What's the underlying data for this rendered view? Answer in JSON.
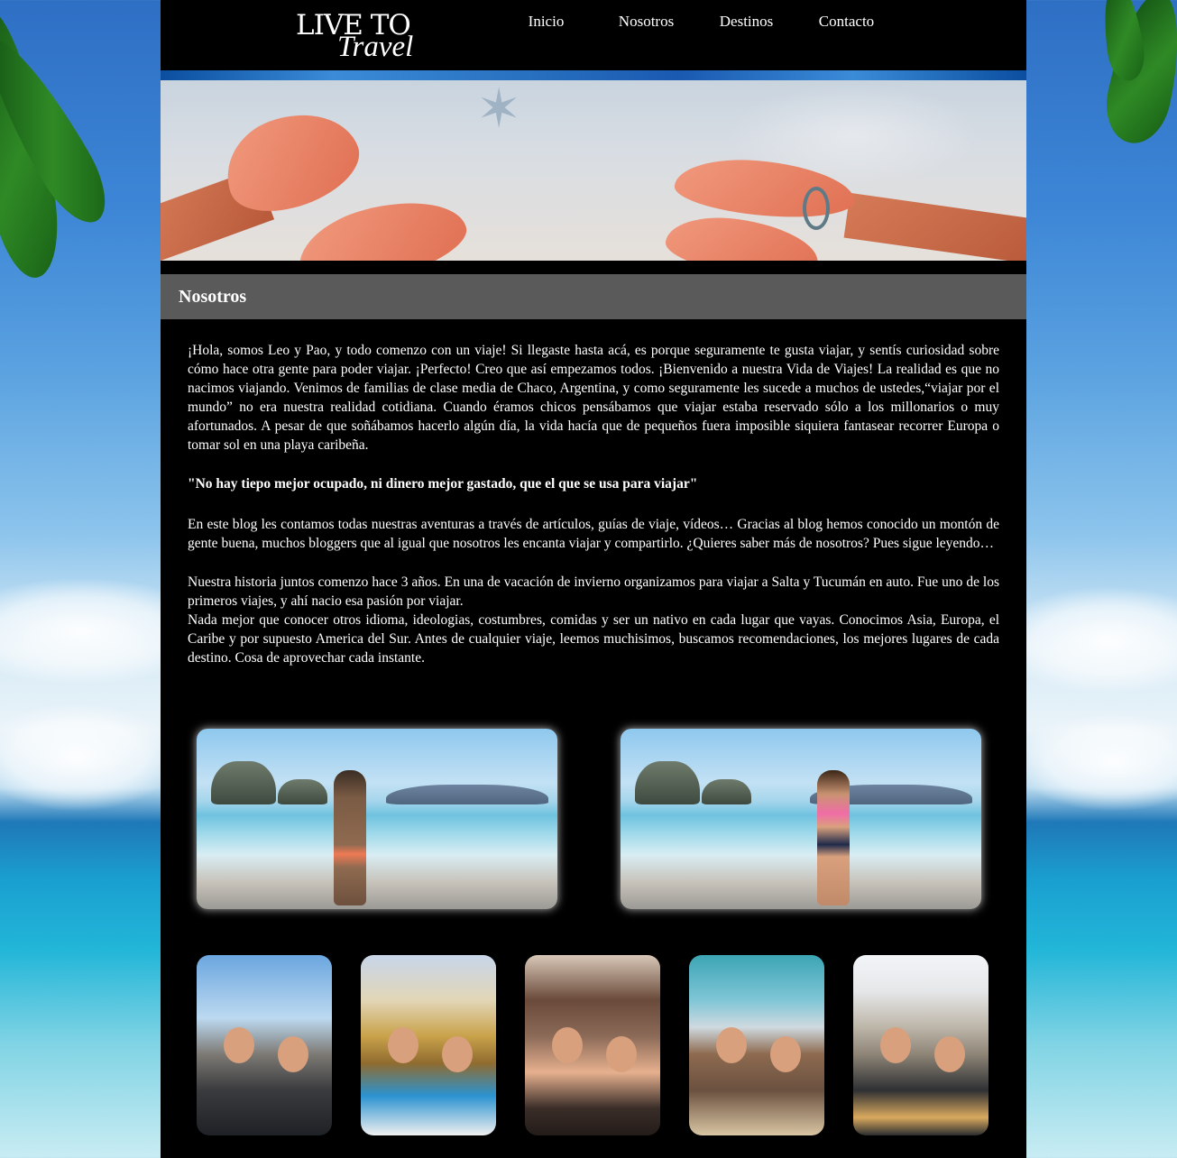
{
  "header": {
    "logo_top": "LIVE TO",
    "logo_bottom": "Travel",
    "nav": [
      "Inicio",
      "Nosotros",
      "Destinos",
      "Contacto"
    ]
  },
  "section": {
    "title": "Nosotros"
  },
  "content": {
    "paragraphs": [
      "¡Hola, somos Leo y Pao, y todo comenzo con un viaje! Si llegaste hasta acá, es porque seguramente te gusta viajar, y sentís curiosidad sobre cómo hace otra gente para poder viajar. ¡Perfecto! Creo que así empezamos todos. ¡Bienvenido a nuestra Vida de Viajes! La realidad es que no nacimos viajando. Venimos de familias de clase media de Chaco, Argentina, y como seguramente les sucede a muchos de ustedes,“viajar por el mundo” no era nuestra realidad cotidiana. Cuando éramos chicos pensábamos que viajar estaba reservado sólo a los millonarios o muy afortunados. A pesar de que soñábamos hacerlo algún día, la vida hacía que de pequeños fuera imposible siquiera fantasear recorrer Europa o tomar sol en una playa caribeña.",
      "\"No hay tiepo mejor ocupado, ni dinero mejor gastado, que el que se usa para viajar\"",
      "En este blog les contamos todas nuestras aventuras a través de artículos, guías de viaje, vídeos… Gracias al blog hemos conocido un montón de gente buena, muchos bloggers que al igual que nosotros les encanta viajar y compartirlo. ¿Quieres saber más de nosotros? Pues sigue leyendo…",
      "Nuestra historia juntos comenzo hace 3 años. En una de vacación de invierno organizamos para viajar a Salta y Tucumán en auto. Fue uno de los primeros viajes, y ahí nacio esa pasión por viajar.",
      "Nada mejor que conocer otros idioma, ideologias, costumbres, comidas y ser un nativo en cada lugar que vayas. Conocimos Asia, Europa, el Caribe y por supuesto America del Sur. Antes de cualquier viaje, leemos muchisimos, buscamos recomendaciones, los mejores lugares de cada destino. Cosa de aprovechar cada instante."
    ]
  },
  "colors": {
    "page_bg": "#000000",
    "section_bar": "#5a5a5a",
    "text": "#ffffff"
  }
}
